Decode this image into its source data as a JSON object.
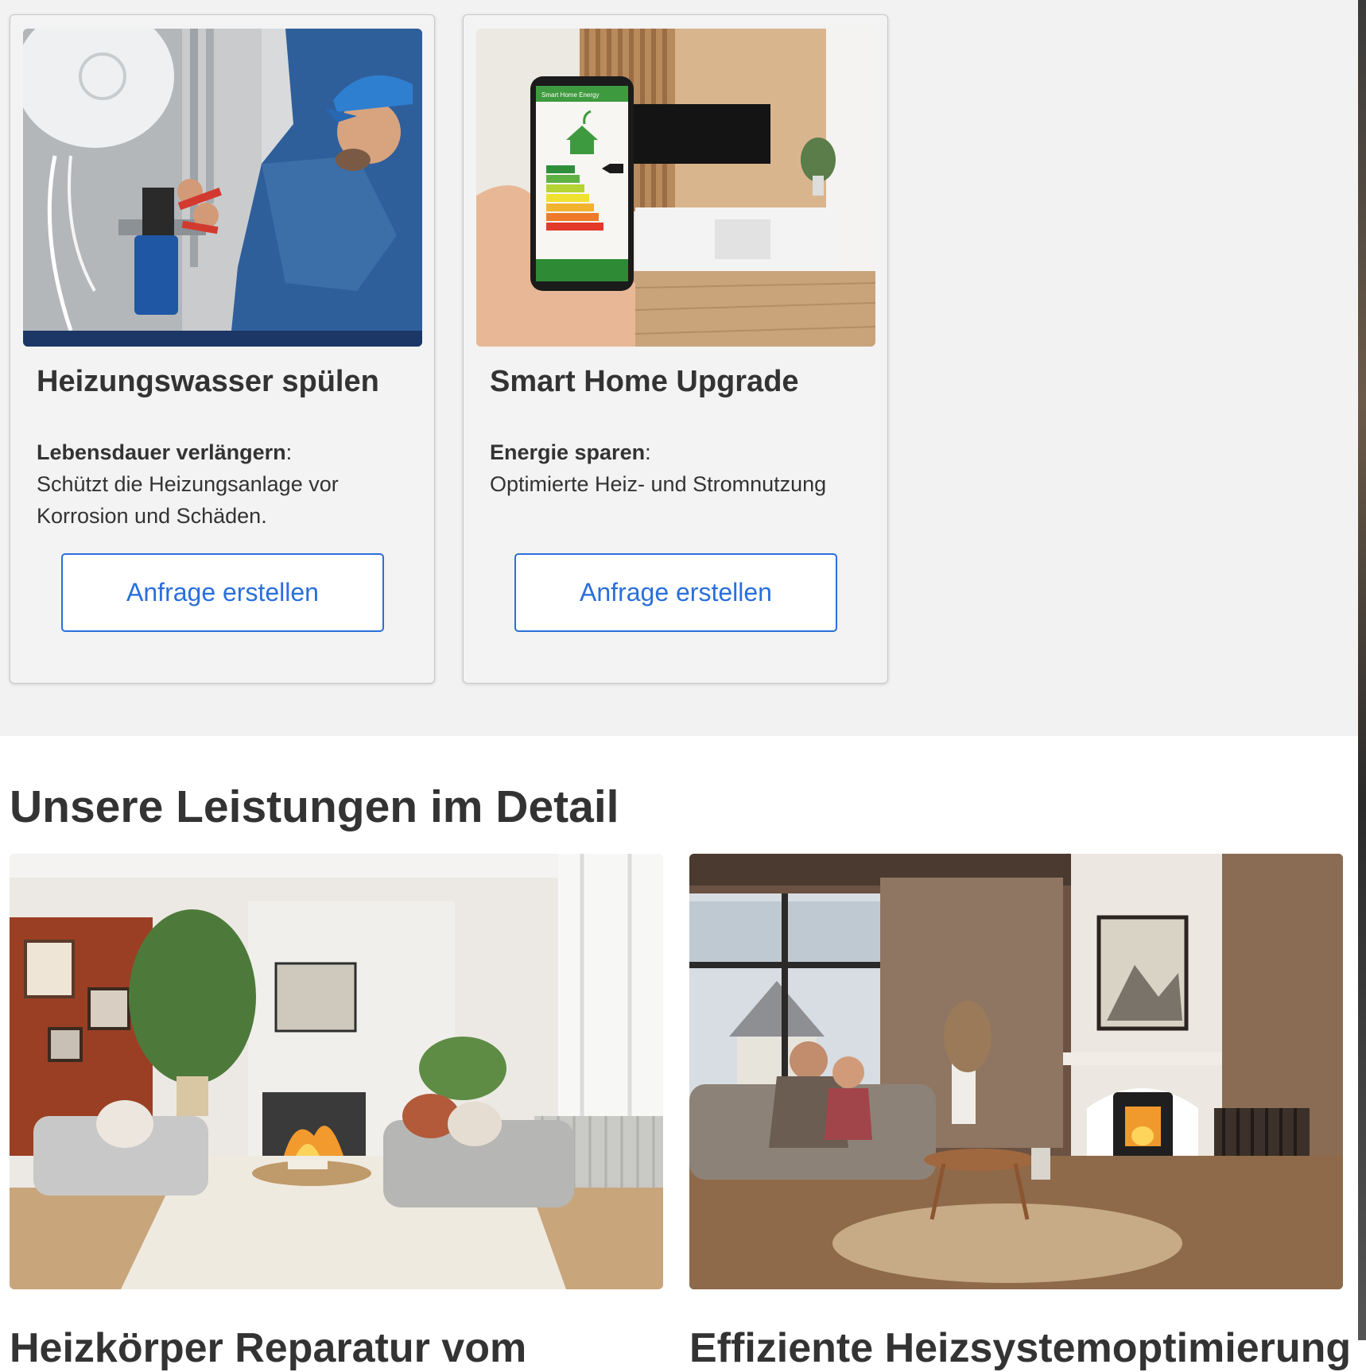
{
  "cards": [
    {
      "title": "Heizungswasser spülen",
      "benefit_label": "Lebensdauer verlängern",
      "benefit_text": "Schützt die Heizungsanlage vor Korrosion und Schäden.",
      "button_label": "Anfrage erstellen",
      "image_subject": "plumber-repairing-pipes"
    },
    {
      "title": "Smart Home Upgrade",
      "benefit_label": "Energie sparen",
      "benefit_text": "Optimierte Heiz- und Stromnutzung",
      "button_label": "Anfrage erstellen",
      "image_subject": "smartphone-energy-app",
      "phone_app_header": "Smart Home Energy"
    }
  ],
  "details": {
    "section_title": "Unsere Leistungen im Detail",
    "items": [
      {
        "title": "Heizkörper Reparatur vom",
        "image_subject": "living-room-fireplace-radiator"
      },
      {
        "title": "Effiziente Heizsystemoptimierung",
        "image_subject": "family-cozy-stove-room"
      }
    ]
  },
  "colors": {
    "accent": "#2a6fdb",
    "text": "#333333",
    "band_background": "#f2f2f2",
    "card_background": "#f3f3f3"
  }
}
